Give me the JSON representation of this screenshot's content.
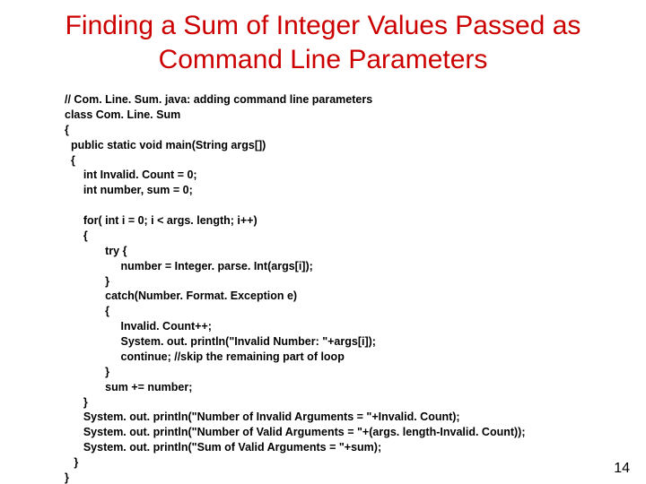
{
  "title": "Finding a Sum of Integer Values Passed as Command Line Parameters",
  "code": "// Com. Line. Sum. java: adding command line parameters\nclass Com. Line. Sum\n{\n  public static void main(String args[])\n  {\n      int Invalid. Count = 0;\n      int number, sum = 0;\n\n      for( int i = 0; i < args. length; i++)\n      {\n             try {\n                  number = Integer. parse. Int(args[i]);\n             }\n             catch(Number. Format. Exception e)\n             {\n                  Invalid. Count++;\n                  System. out. println(\"Invalid Number: \"+args[i]);\n                  continue; //skip the remaining part of loop\n             }\n             sum += number;\n      }\n      System. out. println(\"Number of Invalid Arguments = \"+Invalid. Count);\n      System. out. println(\"Number of Valid Arguments = \"+(args. length-Invalid. Count));\n      System. out. println(\"Sum of Valid Arguments = \"+sum);\n   }\n}",
  "page_number": "14"
}
